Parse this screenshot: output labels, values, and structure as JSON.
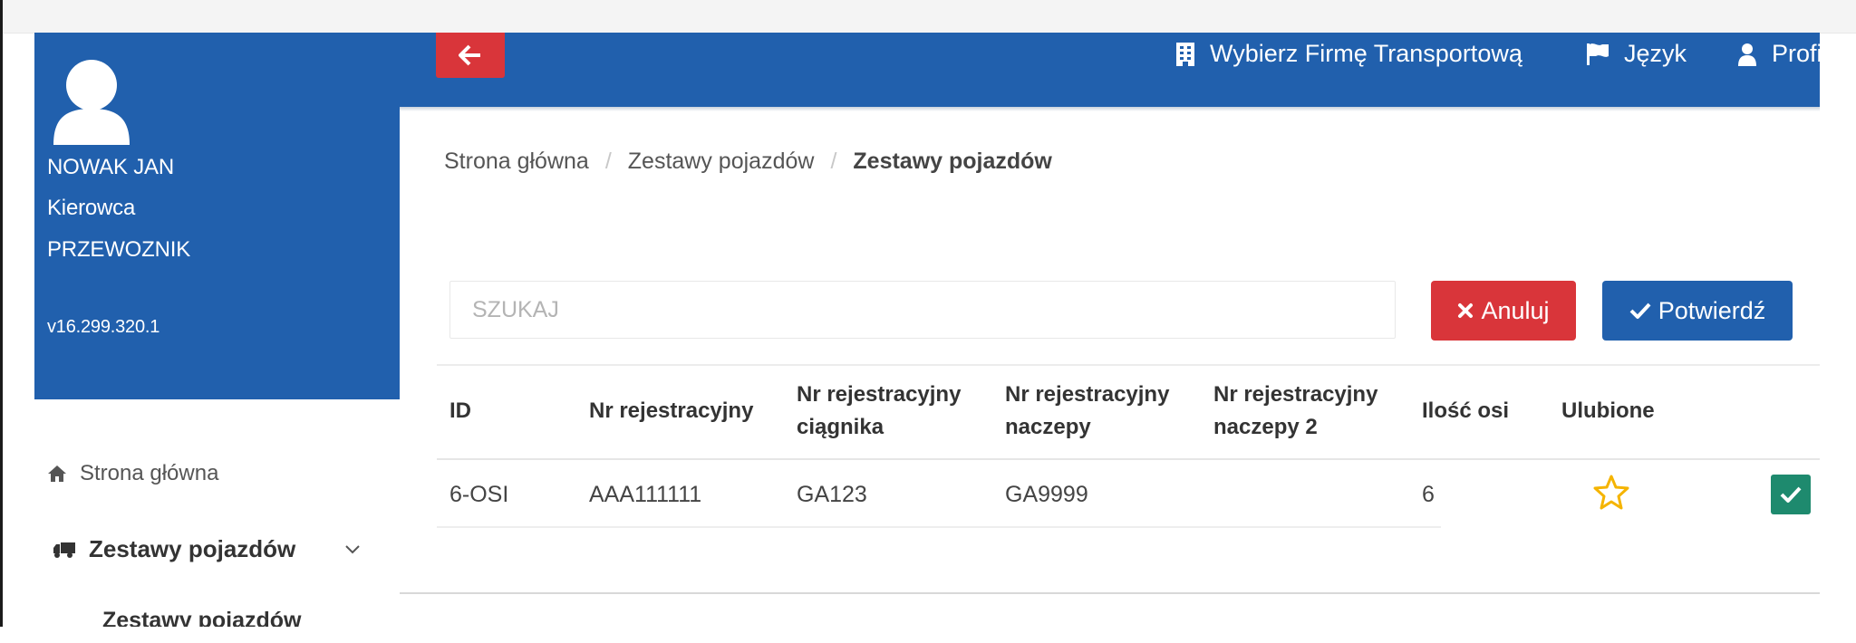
{
  "profile": {
    "name": "NOWAK JAN",
    "role": "Kierowca",
    "company": "PRZEWOZNIK",
    "version": "v16.299.320.1"
  },
  "menu": {
    "home": "Strona główna",
    "vehicle_sets": "Zestawy pojazdów",
    "vehicle_sets_sub": "Zestawy pojazdów"
  },
  "topbar": {
    "choose_company": "Wybierz Firmę Transportową",
    "language": "Język",
    "profile": "Profil"
  },
  "breadcrumb": [
    "Strona główna",
    "Zestawy pojazdów",
    "Zestawy pojazdów"
  ],
  "search": {
    "placeholder": "SZUKAJ",
    "value": ""
  },
  "buttons": {
    "cancel": "Anuluj",
    "confirm": "Potwierdź"
  },
  "table": {
    "columns": [
      "ID",
      "Nr rejestracyjny",
      [
        "Nr rejestracyjny",
        "ciągnika"
      ],
      [
        "Nr rejestracyjny",
        "naczepy"
      ],
      [
        "Nr rejestracyjny",
        "naczepy 2"
      ],
      "Ilość osi",
      "Ulubione"
    ],
    "rows": [
      {
        "id": "6-OSI",
        "reg": "AAA111111",
        "tractor": "GA123",
        "trailer": "GA9999",
        "trailer2": "",
        "axles": "6",
        "favorite": false,
        "selected": true
      }
    ]
  },
  "colors": {
    "primary": "#2160ad",
    "danger": "#d9353a",
    "success": "#1e8a6e",
    "star": "#f5b400"
  },
  "icons": {
    "back": "arrow-left-icon",
    "company": "building-icon",
    "language": "flag-icon",
    "profile": "user-icon",
    "home": "home-icon",
    "sets": "truck-icon",
    "expand": "chevron-down-icon",
    "cancel": "times-icon",
    "confirm": "check-icon",
    "favorite": "star-outline-icon",
    "select": "checkbox-checked-icon"
  }
}
